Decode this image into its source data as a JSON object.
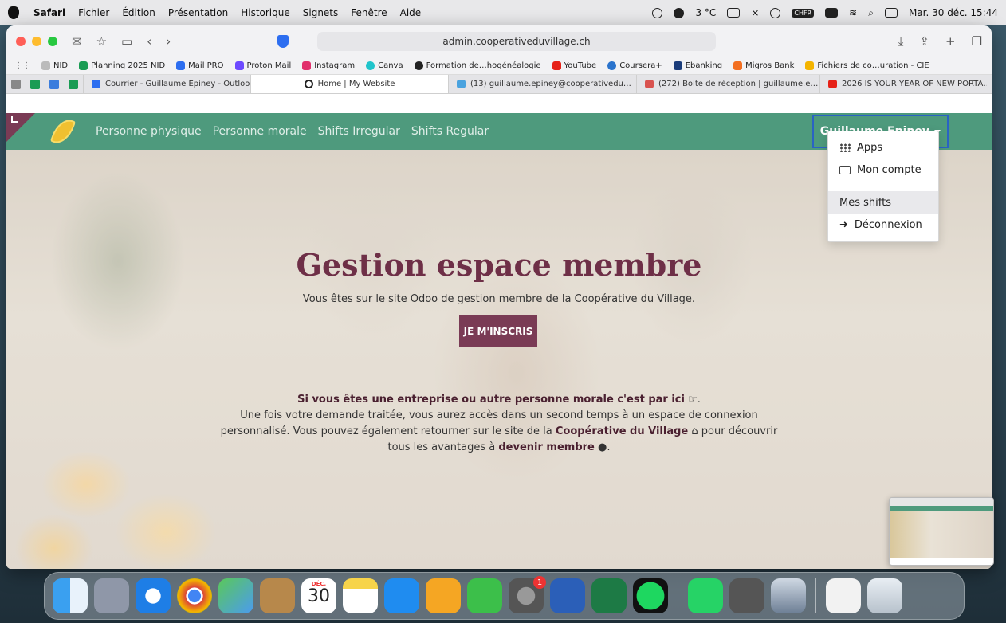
{
  "menubar": {
    "app": "Safari",
    "items": [
      "Fichier",
      "Édition",
      "Présentation",
      "Historique",
      "Signets",
      "Fenêtre",
      "Aide"
    ],
    "weather": "3 °C",
    "clock": "Mar. 30 déc. 15:44",
    "input_badge": "CHFR"
  },
  "browser": {
    "address": "admin.cooperativeduvillage.ch",
    "bookmarks": [
      "NID",
      "Planning 2025 NID",
      "Mail PRO",
      "Proton Mail",
      "Instagram",
      "Canva",
      "Formation de…hogénéalogie",
      "YouTube",
      "Coursera+",
      "Ebanking",
      "Migros Bank",
      "Fichiers de co…uration - CIE"
    ],
    "tabs": [
      {
        "label": "Courrier - Guillaume Epiney - Outlook",
        "active": false
      },
      {
        "label": "Home | My Website",
        "active": true
      },
      {
        "label": "(13) guillaume.epiney@cooperativedu…",
        "active": false
      },
      {
        "label": "(272) Boite de réception | guillaume.e…",
        "active": false
      },
      {
        "label": "2026 IS YOUR YEAR OF NEW PORTA…",
        "active": false
      }
    ]
  },
  "site": {
    "nav": [
      "Personne physique",
      "Personne morale",
      "Shifts Irregular",
      "Shifts Regular"
    ],
    "user": "Guillaume Epiney",
    "dropdown": {
      "apps": "Apps",
      "account": "Mon compte",
      "shifts": "Mes shifts",
      "logout": "Déconnexion"
    },
    "hero": {
      "title": "Gestion espace membre",
      "subtitle": "Vous êtes sur le site Odoo de gestion membre de la Coopérative du Village.",
      "cta": "JE M'INSCRIS"
    },
    "info": {
      "lead": "Si vous êtes une entreprise ou autre personne morale c'est par ici",
      "text1": "Une fois votre demande traitée, vous aurez accès dans un second temps à un espace de connexion personnalisé. Vous pouvez également retourner sur le site de la",
      "link1": "Coopérative du Village",
      "text2": "pour découvrir tous les avantages à",
      "link2": "devenir membre"
    }
  },
  "dock": {
    "calendar_month": "DÉC.",
    "calendar_day": "30",
    "settings_badge": "1"
  },
  "colors": {
    "navbar": "#4e9a7d",
    "brand": "#7a3b55",
    "title": "#6e2f47"
  }
}
